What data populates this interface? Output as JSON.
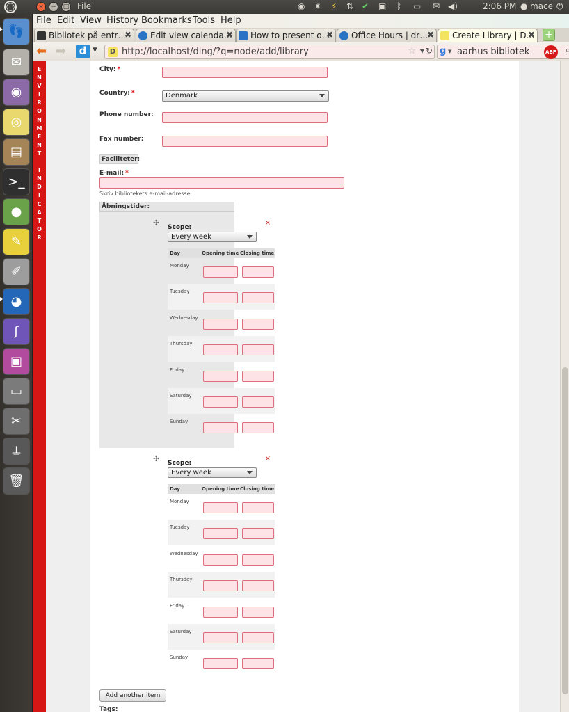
{
  "panel": {
    "title": "File",
    "time": "2:06 PM",
    "user": "mace"
  },
  "menu": [
    "File",
    "Edit",
    "View",
    "History",
    "Bookmarks",
    "Tools",
    "Help"
  ],
  "tabs": [
    "Bibliotek på entr…",
    "Edit view calenda…",
    "How to present o…",
    "Office Hours | dr…",
    "Create Library | D…"
  ],
  "url": "http://localhost/ding/?q=node/add/library",
  "search": "aarhus bibliotek",
  "env_letters": [
    "E",
    "N",
    "V",
    "I",
    "R",
    "O",
    "N",
    "M",
    "E",
    "N",
    "T",
    "",
    "I",
    "N",
    "D",
    "I",
    "C",
    "A",
    "T",
    "O",
    "R"
  ],
  "form": {
    "city": "City:",
    "country": "Country:",
    "country_value": "Denmark",
    "phone": "Phone number:",
    "fax": "Fax number:",
    "faciliteter": "Faciliteter:",
    "email": "E-mail:",
    "email_help": "Skriv bibliotekets e-mail-adresse",
    "hours_title": "Åbningstider:",
    "scope": "Scope:",
    "scope_value": "Every week",
    "col_day": "Day",
    "col_open": "Opening time",
    "col_close": "Closing time",
    "days": [
      "Monday",
      "Tuesday",
      "Wednesday",
      "Thursday",
      "Friday",
      "Saturday",
      "Sunday"
    ],
    "add_button": "Add another item",
    "tags": "Tags:",
    "required": "*",
    "remove": "×",
    "drag": "✣"
  }
}
